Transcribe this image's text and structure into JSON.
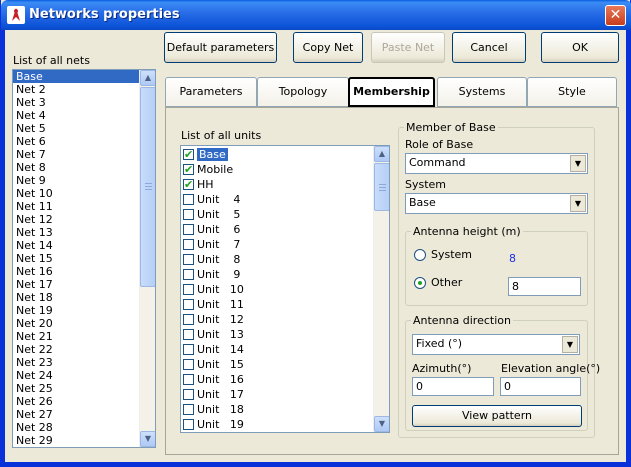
{
  "window": {
    "title": "Networks properties"
  },
  "nets": {
    "label": "List of all nets",
    "items": [
      "Base",
      "Net  2",
      "Net  3",
      "Net  4",
      "Net  5",
      "Net  6",
      "Net  7",
      "Net  8",
      "Net  9",
      "Net 10",
      "Net 11",
      "Net 12",
      "Net 13",
      "Net 14",
      "Net 15",
      "Net 16",
      "Net 17",
      "Net 18",
      "Net 19",
      "Net 20",
      "Net 21",
      "Net 22",
      "Net 23",
      "Net 24",
      "Net 25",
      "Net 26",
      "Net 27",
      "Net 28",
      "Net 29"
    ],
    "selected": "Base"
  },
  "toolbar": {
    "default_label": "Default parameters",
    "copy_label": "Copy Net",
    "paste_label": "Paste Net",
    "cancel_label": "Cancel",
    "ok_label": "OK"
  },
  "tabs": [
    "Parameters",
    "Topology",
    "Membership",
    "Systems",
    "Style"
  ],
  "active_tab": "Membership",
  "units": {
    "label": "List of all units",
    "items": [
      {
        "label": "Base",
        "checked": true
      },
      {
        "label": "Mobile",
        "checked": true
      },
      {
        "label": "HH",
        "checked": true
      },
      {
        "label": "Unit    4",
        "checked": false
      },
      {
        "label": "Unit    5",
        "checked": false
      },
      {
        "label": "Unit    6",
        "checked": false
      },
      {
        "label": "Unit    7",
        "checked": false
      },
      {
        "label": "Unit    8",
        "checked": false
      },
      {
        "label": "Unit    9",
        "checked": false
      },
      {
        "label": "Unit   10",
        "checked": false
      },
      {
        "label": "Unit   11",
        "checked": false
      },
      {
        "label": "Unit   12",
        "checked": false
      },
      {
        "label": "Unit   13",
        "checked": false
      },
      {
        "label": "Unit   14",
        "checked": false
      },
      {
        "label": "Unit   15",
        "checked": false
      },
      {
        "label": "Unit   16",
        "checked": false
      },
      {
        "label": "Unit   17",
        "checked": false
      },
      {
        "label": "Unit   18",
        "checked": false
      },
      {
        "label": "Unit   19",
        "checked": false
      }
    ]
  },
  "member": {
    "group_title": "Member of Base",
    "role_label": "Role of Base",
    "role_value": "Command",
    "system_label": "System",
    "system_value": "Base",
    "antenna_height": {
      "title": "Antenna height (m)",
      "system_label": "System",
      "system_value": "8",
      "other_label": "Other",
      "other_value": "8",
      "selected": "Other"
    },
    "antenna_direction": {
      "title": "Antenna direction",
      "mode_value": "Fixed (°)",
      "azimuth_label": "Azimuth(°)",
      "azimuth_value": "0",
      "elevation_label": "Elevation angle(°)",
      "elevation_value": "0",
      "view_pattern_label": "View pattern"
    }
  },
  "colors": {
    "title_bar": "#0a5fe0",
    "selection": "#316ac5",
    "check": "#21a121",
    "system_value": "#1f2ee0"
  }
}
